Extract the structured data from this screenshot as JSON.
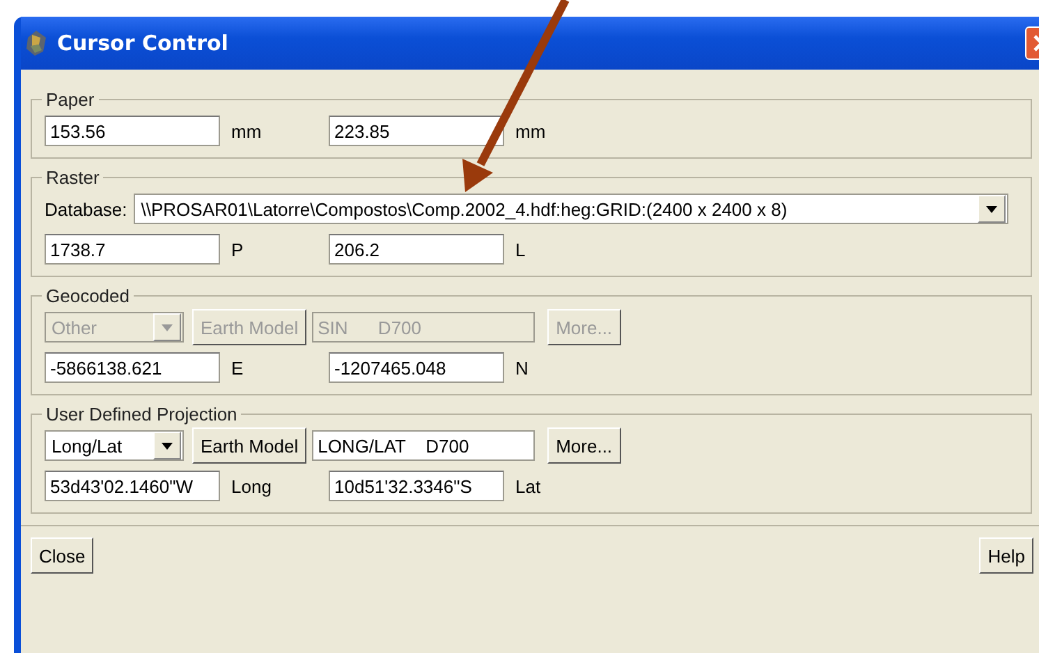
{
  "window": {
    "title": "Cursor Control"
  },
  "paper": {
    "title": "Paper",
    "fields": [
      {
        "value": "153.56",
        "unit": "mm"
      },
      {
        "value": "223.85",
        "unit": "mm"
      }
    ]
  },
  "raster": {
    "title": "Raster",
    "database_label": "Database:",
    "database": "\\\\PROSAR01\\Latorre\\Compostos\\Comp.2002_4.hdf:heg:GRID:(2400 x 2400 x 8)",
    "fields": [
      {
        "value": "1738.7",
        "unit": "P"
      },
      {
        "value": "206.2",
        "unit": "L"
      }
    ]
  },
  "projections": [
    {
      "title": "Geocoded",
      "disabled": true,
      "projection": "Other",
      "earth_model_button": "Earth Model",
      "model": "SIN      D700",
      "more_button": "More...",
      "fields": [
        {
          "value": "-5866138.621",
          "unit": "E"
        },
        {
          "value": "-1207465.048",
          "unit": "N"
        }
      ]
    },
    {
      "title": "User Defined Projection",
      "disabled": false,
      "projection": "Long/Lat",
      "earth_model_button": "Earth Model",
      "model": "LONG/LAT    D700",
      "more_button": "More...",
      "fields": [
        {
          "value": "53d43'02.1460\"W",
          "unit": "Long"
        },
        {
          "value": "10d51'32.3346\"S",
          "unit": "Lat"
        }
      ]
    }
  ],
  "buttons": {
    "close": "Close",
    "help": "Help"
  }
}
